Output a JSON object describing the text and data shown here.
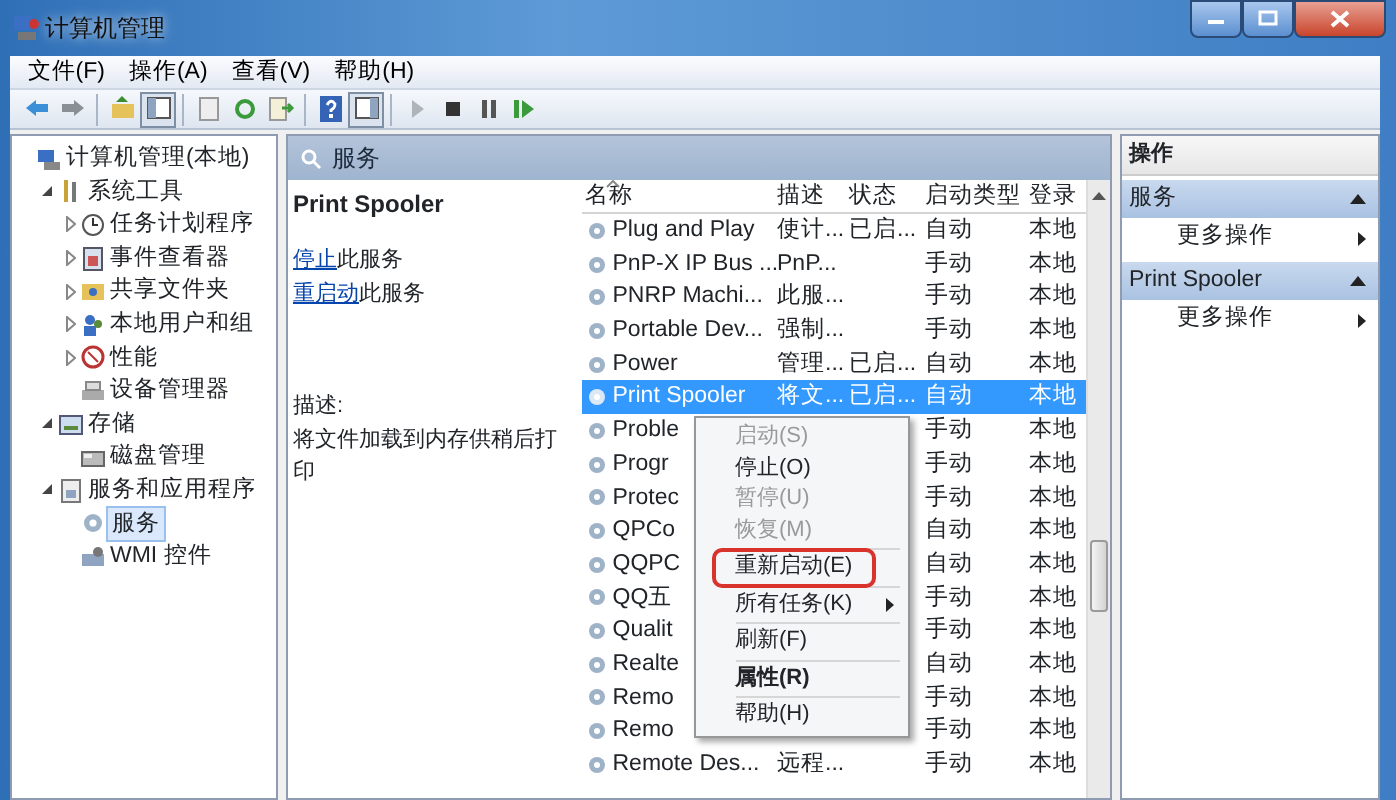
{
  "window": {
    "title": "计算机管理"
  },
  "menu": [
    "文件(F)",
    "操作(A)",
    "查看(V)",
    "帮助(H)"
  ],
  "tree": [
    {
      "label": "计算机管理(本地)",
      "selected": false,
      "children": [
        {
          "label": "系统工具",
          "selected": false,
          "expanded": true,
          "children": [
            {
              "label": "任务计划程序",
              "selected": false,
              "expanded": false
            },
            {
              "label": "事件查看器",
              "selected": false,
              "expanded": false
            },
            {
              "label": "共享文件夹",
              "selected": false,
              "expanded": false
            },
            {
              "label": "本地用户和组",
              "selected": false,
              "expanded": false
            },
            {
              "label": "性能",
              "selected": false,
              "expanded": false
            },
            {
              "label": "设备管理器",
              "selected": false
            }
          ]
        },
        {
          "label": "存储",
          "selected": false,
          "expanded": true,
          "children": [
            {
              "label": "磁盘管理",
              "selected": false
            }
          ]
        },
        {
          "label": "服务和应用程序",
          "selected": false,
          "expanded": true,
          "children": [
            {
              "label": "服务",
              "selected": true
            },
            {
              "label": "WMI 控件",
              "selected": false
            }
          ]
        }
      ]
    }
  ],
  "panel": {
    "title": "服务"
  },
  "detail": {
    "service_name": "Print Spooler",
    "actions": [
      {
        "link": "停止",
        "text": "此服务"
      },
      {
        "link": "重启动",
        "text": "此服务"
      }
    ],
    "description_label": "描述:",
    "description": "将文件加载到内存供稍后打印"
  },
  "table": {
    "columns": [
      {
        "label": "名称",
        "sorted": true
      },
      {
        "label": "描述",
        "sorted": false
      },
      {
        "label": "状态",
        "sorted": false
      },
      {
        "label": "启动类型",
        "sorted": false
      },
      {
        "label": "登录",
        "sorted": false
      }
    ],
    "rows": [
      {
        "name": "Plug and Play",
        "description": "使计...",
        "status": "已启...",
        "startup": "自动",
        "logon": "本地",
        "selected": false
      },
      {
        "name": "PnP-X IP Bus ...",
        "description": "PnP...",
        "startup": "手动",
        "logon": "本地",
        "selected": false
      },
      {
        "name": "PNRP Machi...",
        "description": "此服...",
        "startup": "手动",
        "logon": "本地",
        "selected": false
      },
      {
        "name": "Portable Dev...",
        "description": "强制...",
        "startup": "手动",
        "logon": "本地",
        "selected": false
      },
      {
        "name": "Power",
        "description": "管理...",
        "status": "已启...",
        "startup": "自动",
        "logon": "本地",
        "selected": false
      },
      {
        "name": "Print Spooler",
        "description": "将文...",
        "status": "已启...",
        "startup": "自动",
        "logon": "本地",
        "selected": true
      },
      {
        "name": "Proble",
        "startup": "手动",
        "logon": "本地",
        "selected": false
      },
      {
        "name": "Progr",
        "startup": "手动",
        "logon": "本地",
        "selected": false
      },
      {
        "name": "Protec",
        "startup": "手动",
        "logon": "本地",
        "selected": false
      },
      {
        "name": "QPCo",
        "startup": "自动",
        "logon": "本地",
        "selected": false
      },
      {
        "name": "QQPC",
        "startup": "自动",
        "logon": "本地",
        "selected": false
      },
      {
        "name": "QQ五",
        "startup": "手动",
        "logon": "本地",
        "selected": false
      },
      {
        "name": "Qualit",
        "startup": "手动",
        "logon": "本地",
        "selected": false
      },
      {
        "name": "Realte",
        "startup": "自动",
        "logon": "本地",
        "selected": false
      },
      {
        "name": "Remo",
        "startup": "手动",
        "logon": "本地",
        "selected": false
      },
      {
        "name": "Remo",
        "startup": "手动",
        "logon": "本地",
        "selected": false
      },
      {
        "name": "Remote Des...",
        "description": "远程...",
        "startup": "手动",
        "logon": "本地",
        "selected": false
      }
    ]
  },
  "context_menu": [
    {
      "kind": "item",
      "label": "启动(S)",
      "disabled": true,
      "default": false,
      "submenu": false,
      "outlined": false
    },
    {
      "kind": "item",
      "label": "停止(O)",
      "disabled": false,
      "default": false,
      "submenu": false,
      "outlined": false
    },
    {
      "kind": "item",
      "label": "暂停(U)",
      "disabled": true,
      "default": false,
      "submenu": false,
      "outlined": false
    },
    {
      "kind": "item",
      "label": "恢复(M)",
      "disabled": true,
      "default": false,
      "submenu": false,
      "outlined": false
    },
    {
      "kind": "separator"
    },
    {
      "kind": "item",
      "label": "重新启动(E)",
      "disabled": false,
      "default": false,
      "submenu": false,
      "outlined": true
    },
    {
      "kind": "separator"
    },
    {
      "kind": "item",
      "label": "所有任务(K)",
      "disabled": false,
      "default": false,
      "submenu": true,
      "outlined": false
    },
    {
      "kind": "separator"
    },
    {
      "kind": "item",
      "label": "刷新(F)",
      "disabled": false,
      "default": false,
      "submenu": false,
      "outlined": false
    },
    {
      "kind": "separator"
    },
    {
      "kind": "item",
      "label": "属性(R)",
      "disabled": false,
      "default": true,
      "submenu": false,
      "outlined": false
    },
    {
      "kind": "separator"
    },
    {
      "kind": "item",
      "label": "帮助(H)",
      "disabled": false,
      "default": false,
      "submenu": false,
      "outlined": false
    }
  ],
  "actions_pane": {
    "title": "操作",
    "sections": [
      {
        "title": "服务",
        "expanded": true,
        "items": [
          "更多操作"
        ]
      },
      {
        "title": "Print Spooler",
        "expanded": true,
        "items": [
          "更多操作"
        ]
      }
    ]
  }
}
